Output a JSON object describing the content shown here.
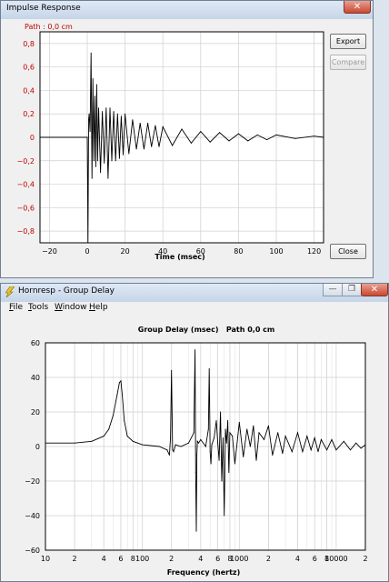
{
  "impulse_window": {
    "title": "Impulse Response",
    "path_label": "Path : 0,0 cm",
    "export_label": "Export",
    "compare_label": "Compare",
    "close_label": "Close",
    "close_glyph": "✕"
  },
  "group_delay_window": {
    "title": "Hornresp - Group Delay",
    "menu": [
      {
        "accel": "F",
        "rest": "ile"
      },
      {
        "accel": "T",
        "rest": "ools"
      },
      {
        "accel": "W",
        "rest": "indow"
      },
      {
        "accel": "H",
        "rest": "elp"
      }
    ],
    "minimize_glyph": "—",
    "restore_glyph": "❐",
    "close_glyph": "✕"
  },
  "colors": {
    "impulse_tick_color": "#c00000",
    "path_label_color": "#c00000",
    "plot_background": "#ffffff",
    "curve_color": "#000000",
    "grid_color": "#cfcfcf"
  },
  "chart_data": [
    {
      "type": "line",
      "title": "",
      "xlabel": "Time (msec)",
      "ylabel": "",
      "xlim": [
        -25,
        125
      ],
      "ylim": [
        -0.9,
        0.9
      ],
      "x_ticks": [
        -20,
        0,
        20,
        40,
        60,
        80,
        100,
        120
      ],
      "x_tick_labels": [
        "−20",
        "0",
        "20",
        "40",
        "60",
        "80",
        "100",
        "120"
      ],
      "y_ticks": [
        0.8,
        0.6,
        0.4,
        0.2,
        0,
        -0.2,
        -0.4,
        -0.6,
        -0.8
      ],
      "y_tick_labels": [
        "0,8",
        "0,6",
        "0,4",
        "0,2",
        "0",
        "−0,2",
        "−0,4",
        "−0,6",
        "−0,8"
      ],
      "grid": true,
      "series": [
        {
          "x": [
            -25,
            0,
            0.2,
            0.4,
            0.7,
            1,
            1.5,
            2,
            2.5,
            3,
            3.5,
            4,
            4.5,
            5,
            5.5,
            6,
            7,
            8,
            9,
            10,
            11,
            12,
            13,
            14,
            15,
            16,
            17,
            18,
            19,
            20,
            22,
            24,
            26,
            28,
            30,
            32,
            34,
            36,
            38,
            40,
            45,
            50,
            55,
            60,
            65,
            70,
            75,
            80,
            85,
            90,
            95,
            100,
            110,
            120,
            125
          ],
          "y": [
            0,
            0,
            -0.4,
            -0.9,
            0.15,
            0.2,
            0.05,
            0.72,
            -0.35,
            0.5,
            -0.2,
            0.35,
            -0.25,
            0.45,
            -0.2,
            0.25,
            -0.3,
            0.22,
            -0.22,
            0.25,
            -0.35,
            0.25,
            -0.2,
            0.22,
            -0.2,
            0.2,
            -0.18,
            0.18,
            -0.15,
            0.2,
            -0.14,
            0.15,
            -0.1,
            0.12,
            -0.1,
            0.12,
            -0.08,
            0.1,
            -0.08,
            0.09,
            -0.07,
            0.07,
            -0.05,
            0.05,
            -0.04,
            0.04,
            -0.03,
            0.03,
            -0.03,
            0.02,
            -0.02,
            0.02,
            -0.01,
            0.01,
            0
          ]
        }
      ]
    },
    {
      "type": "line",
      "title": "Group Delay (msec)   Path 0,0 cm",
      "xlabel": "Frequency (hertz)",
      "ylabel": "",
      "x_scale": "log",
      "xlim": [
        10,
        20000
      ],
      "ylim": [
        -60,
        60
      ],
      "x_tick_labels": [
        "10",
        "2",
        "4",
        "6",
        "8",
        "100",
        "2",
        "4",
        "6",
        "8",
        "1000",
        "2",
        "4",
        "6",
        "8",
        "10000",
        "2"
      ],
      "x_ticks": [
        10,
        20,
        40,
        60,
        80,
        100,
        200,
        400,
        600,
        800,
        1000,
        2000,
        4000,
        6000,
        8000,
        10000,
        20000
      ],
      "y_ticks": [
        60,
        40,
        20,
        0,
        -20,
        -40,
        -60
      ],
      "y_tick_labels": [
        "60",
        "40",
        "20",
        "0",
        "−20",
        "−40",
        "−60"
      ],
      "grid": true,
      "series": [
        {
          "x": [
            10,
            20,
            30,
            40,
            45,
            50,
            55,
            58,
            60,
            62,
            65,
            70,
            80,
            100,
            150,
            180,
            190,
            195,
            200,
            205,
            210,
            220,
            250,
            300,
            340,
            350,
            355,
            360,
            365,
            370,
            380,
            400,
            450,
            480,
            490,
            500,
            510,
            520,
            550,
            580,
            600,
            620,
            640,
            660,
            680,
            700,
            720,
            740,
            760,
            780,
            800,
            850,
            900,
            1000,
            1100,
            1200,
            1300,
            1400,
            1500,
            1600,
            1800,
            2000,
            2200,
            2500,
            2800,
            3000,
            3500,
            4000,
            4500,
            5000,
            5500,
            6000,
            6500,
            7000,
            8000,
            9000,
            10000,
            12000,
            14000,
            16000,
            18000,
            20000
          ],
          "y": [
            2,
            2,
            3,
            6,
            10,
            18,
            30,
            37,
            38,
            30,
            15,
            6,
            3,
            1,
            0,
            -2,
            -5,
            5,
            44,
            -2,
            -3,
            1,
            0,
            2,
            8,
            56,
            -15,
            -49,
            -5,
            3,
            2,
            4,
            0,
            10,
            45,
            -3,
            -10,
            1,
            5,
            15,
            2,
            -8,
            20,
            -20,
            5,
            -40,
            10,
            2,
            15,
            -15,
            8,
            6,
            -10,
            14,
            -6,
            10,
            0,
            12,
            -8,
            8,
            4,
            12,
            -5,
            8,
            -4,
            6,
            -3,
            8,
            -3,
            6,
            -2,
            5,
            -3,
            4,
            -2,
            4,
            -2,
            3,
            -2,
            2,
            -1,
            1
          ]
        }
      ]
    }
  ]
}
